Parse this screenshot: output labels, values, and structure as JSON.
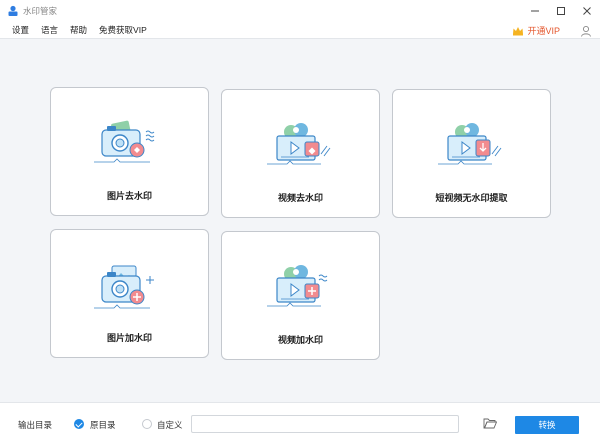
{
  "window": {
    "title": "水印管家",
    "minimize_icon": "minimize-icon",
    "maximize_icon": "maximize-icon",
    "close_icon": "close-icon"
  },
  "menu": {
    "items": [
      {
        "label": "设置"
      },
      {
        "label": "语言"
      },
      {
        "label": "帮助"
      },
      {
        "label": "免费获取VIP"
      }
    ],
    "vip_label": "开通VIP",
    "vip_color": "#e4572e"
  },
  "cards": [
    {
      "label": "图片去水印",
      "icon": "photo-remove-watermark-icon"
    },
    {
      "label": "视频去水印",
      "icon": "video-remove-watermark-icon"
    },
    {
      "label": "短视频无水印提取",
      "icon": "short-video-extract-icon"
    },
    {
      "label": "图片加水印",
      "icon": "photo-add-watermark-icon"
    },
    {
      "label": "视频加水印",
      "icon": "video-add-watermark-icon"
    }
  ],
  "bottom": {
    "output_label": "输出目录",
    "option_original": "原目录",
    "option_custom": "自定义",
    "selected": "原目录",
    "path_value": "",
    "convert_label": "转换",
    "accent_color": "#1e88e5"
  }
}
